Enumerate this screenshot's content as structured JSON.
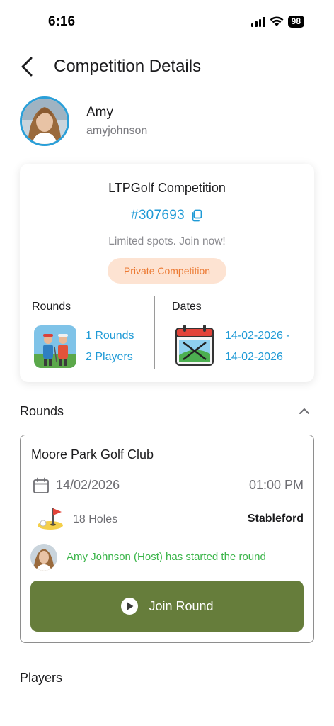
{
  "status_bar": {
    "time": "6:16",
    "battery": "98"
  },
  "header": {
    "title": "Competition Details"
  },
  "profile": {
    "name": "Amy",
    "username": "amyjohnson"
  },
  "competition": {
    "title": "LTPGolf Competition",
    "id": "#307693",
    "tagline": "Limited spots. Join now!",
    "badge": "Private Competition",
    "rounds_label": "Rounds",
    "rounds_count": "1 Rounds",
    "players_count": "2 Players",
    "dates_label": "Dates",
    "date_start": "14-02-2026 -",
    "date_end": "14-02-2026"
  },
  "rounds_section": {
    "title": "Rounds"
  },
  "round": {
    "club": "Moore Park Golf Club",
    "date": "14/02/2026",
    "time": "01:00 PM",
    "holes": "18 Holes",
    "format": "Stableford",
    "host_status": "Amy Johnson (Host) has started the round",
    "join_label": "Join Round"
  },
  "players_section": {
    "title": "Players"
  },
  "colors": {
    "accent_blue": "#1f9ad6",
    "badge_bg": "#fde3d2",
    "badge_text": "#ec7a33",
    "join_button": "#667d3b",
    "host_status_green": "#3bb54a"
  },
  "icons": [
    "back-chevron-icon",
    "copy-icon",
    "golfers-icon",
    "calendar-golf-icon",
    "calendar-icon",
    "golf-hole-icon",
    "play-icon",
    "chevron-up-icon"
  ]
}
